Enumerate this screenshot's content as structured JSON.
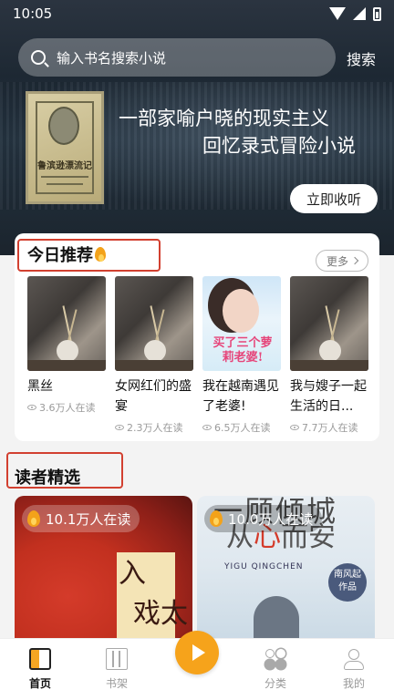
{
  "status_bar": {
    "time": "10:05"
  },
  "search": {
    "placeholder": "输入书名搜索小说",
    "action_label": "搜索"
  },
  "hero": {
    "cover_title": "鲁滨逊漂流记",
    "line1": "一部家喻户晓的现实主义",
    "line2": "回忆录式冒险小说",
    "collect_label": "立即收听"
  },
  "today": {
    "title": "今日推荐",
    "title_icon": "flame-icon",
    "more_label": "更多",
    "books": [
      {
        "title": "黑丝",
        "reads": "3.6万人在读"
      },
      {
        "title": "女网红们的盛宴",
        "reads": "2.3万人在读"
      },
      {
        "title": "我在越南遇见了老婆!",
        "reads": "6.5万人在读",
        "cover_text": "买了三个萝莉老婆!"
      },
      {
        "title": "我与嫂子一起生活的日...",
        "reads": "7.7万人在读"
      }
    ]
  },
  "reader_picks": {
    "title": "读者精选",
    "items": [
      {
        "reads": "10.1万人在读",
        "cover_text_1": "入",
        "cover_text_2": "戏太"
      },
      {
        "reads": "10.0万人在读",
        "cover_text_1": "一顾倾城",
        "cover_text_2a": "从",
        "cover_text_2b": "心",
        "cover_text_2c": "而安",
        "cover_en": "YIGU QINGCHEN",
        "author": "南风起 作品"
      }
    ]
  },
  "tabbar": {
    "tabs": [
      {
        "label": "首页",
        "icon": "home-icon",
        "active": true
      },
      {
        "label": "书架",
        "icon": "bookshelf-icon"
      },
      {
        "label": "分类",
        "icon": "category-icon"
      },
      {
        "label": "我的",
        "icon": "profile-icon"
      }
    ],
    "center_icon": "play-icon"
  },
  "colors": {
    "accent": "#f6a31b",
    "highlight_box": "#d24030",
    "text": "#111111",
    "muted": "#9a9a9a"
  }
}
